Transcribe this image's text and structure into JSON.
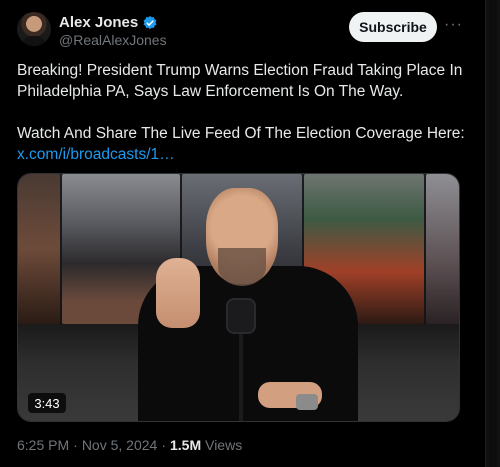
{
  "author": {
    "display_name": "Alex Jones",
    "handle": "@RealAlexJones",
    "verified_icon": "verified-badge-icon",
    "verified_color": "#1d9bf0"
  },
  "actions": {
    "subscribe_label": "Subscribe",
    "more_icon": "more-horizontal-icon",
    "more_glyph": "···"
  },
  "tweet": {
    "paragraph_1": "Breaking! President Trump Warns Election Fraud Taking Place In Philadelphia PA, Says Law Enforcement Is On The Way.",
    "paragraph_2": "Watch And Share The Live Feed Of The Election Coverage Here:",
    "link_text": "x.com/i/broadcasts/1…",
    "link_color": "#1d9bf0"
  },
  "media": {
    "duration": "3:43"
  },
  "meta": {
    "time": "6:25 PM",
    "separator_1": "·",
    "date": "Nov 5, 2024",
    "separator_2": "·",
    "views_count": "1.5M",
    "views_label": "Views"
  }
}
